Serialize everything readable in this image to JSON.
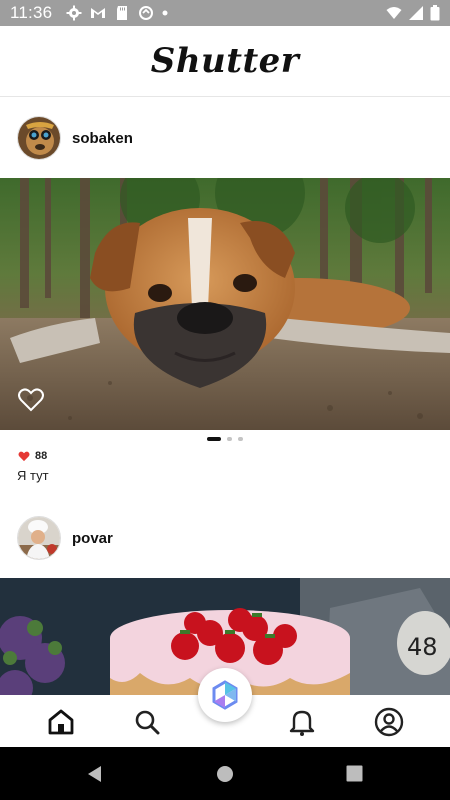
{
  "status_bar": {
    "time": "11:36"
  },
  "header": {
    "title": "Shutter"
  },
  "posts": [
    {
      "username": "sobaken",
      "likes": "88",
      "caption": "Я тут",
      "image": "boxer-dog-photo"
    },
    {
      "username": "povar",
      "image": "strawberry-cake-photo"
    }
  ],
  "bottom_nav": [
    "home-icon",
    "search-icon",
    "create-icon",
    "bell-icon",
    "profile-icon"
  ],
  "colors": {
    "accent": "#111111",
    "like": "#e53935",
    "status_bar": "#9e9e9e"
  }
}
